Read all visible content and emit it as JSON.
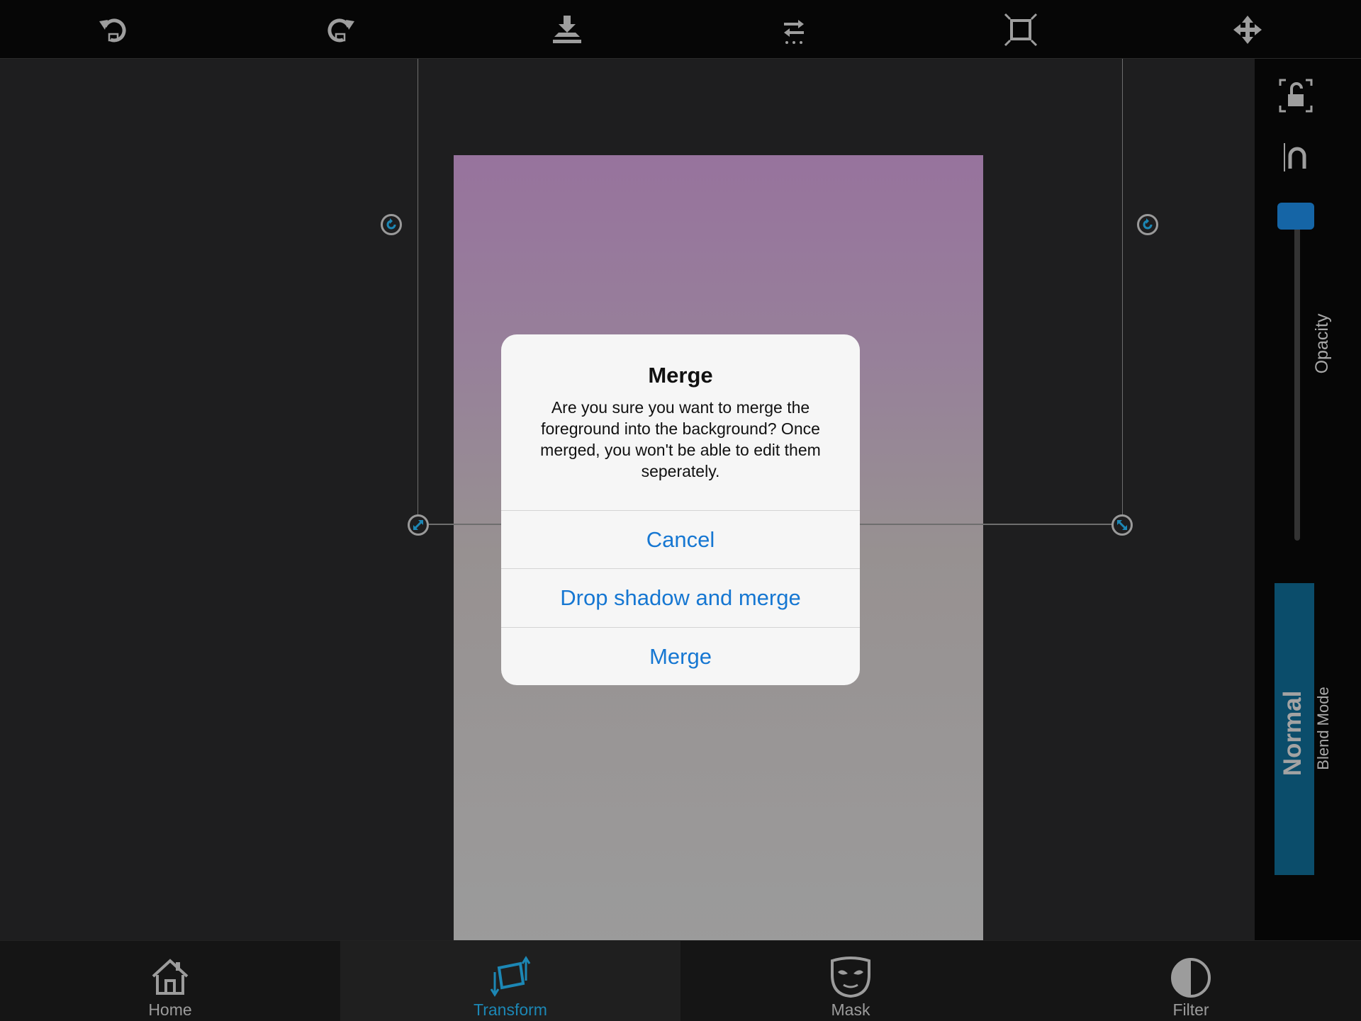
{
  "toolbar": {
    "items": [
      {
        "name": "undo-icon"
      },
      {
        "name": "redo-icon"
      },
      {
        "name": "merge-down-icon"
      },
      {
        "name": "flip-icon"
      },
      {
        "name": "fit-screen-icon"
      },
      {
        "name": "move-icon"
      }
    ],
    "icon_color": "#9e9e9e"
  },
  "canvas": {
    "photo_gradient": [
      "#97739d",
      "#9b9b9b"
    ],
    "handle_accent": "#1c87b5"
  },
  "right_panel": {
    "lock_icon": "unlock-icon",
    "magnet_icon": "magnet-icon",
    "opacity_label": "Opacity",
    "opacity_value": 1.0,
    "blend_mode_value": "Normal",
    "blend_mode_label": "Blend Mode"
  },
  "bottom_tabs": [
    {
      "label": "Home",
      "icon": "home-icon",
      "active": false
    },
    {
      "label": "Transform",
      "icon": "transform-icon",
      "active": true
    },
    {
      "label": "Mask",
      "icon": "mask-icon",
      "active": false
    },
    {
      "label": "Filter",
      "icon": "filter-icon",
      "active": false
    }
  ],
  "dialog": {
    "title": "Merge",
    "message": "Are you sure you want to merge the foreground into the background? Once merged, you won't be able to edit them seperately.",
    "buttons": {
      "cancel": "Cancel",
      "drop_shadow_merge": "Drop shadow and merge",
      "merge": "Merge"
    },
    "button_color": "#1677d2"
  }
}
